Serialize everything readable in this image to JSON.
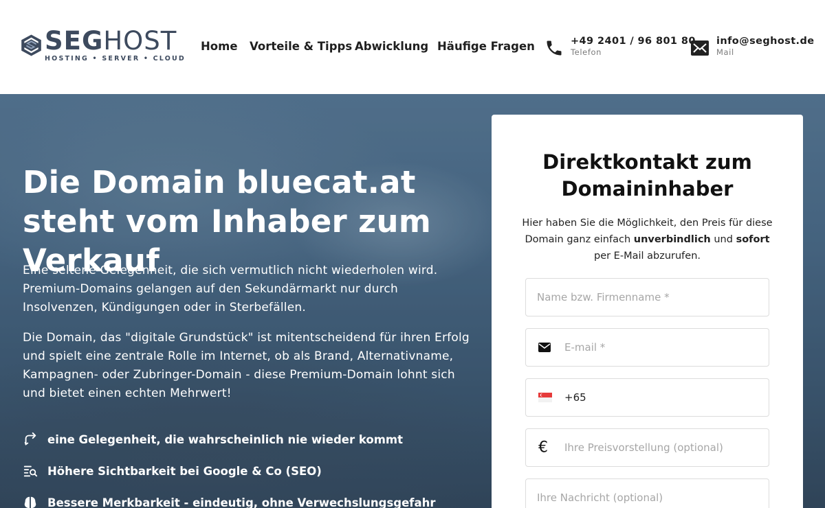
{
  "header": {
    "logo": {
      "name_bold": "SEG",
      "name_light": "HOST",
      "tagline": "HOSTING • SERVER • CLOUD"
    },
    "nav": [
      {
        "label": "Home"
      },
      {
        "label": "Vorteile & Tipps"
      },
      {
        "label": "Abwicklung"
      },
      {
        "label": "Häufige Fragen"
      }
    ],
    "phone": {
      "value": "+49 2401 / 96 801 80",
      "label": "Telefon",
      "icon": "phone-icon"
    },
    "mail": {
      "value": "info@seghost.de",
      "label": "Mail",
      "icon": "mail-icon"
    }
  },
  "hero": {
    "title": "Die Domain bluecat.at steht vom Inhaber zum Verkauf",
    "paragraph1": "Eine seltene Gelegenheit, die sich vermutlich nicht wiederholen wird. Premium-Domains gelangen auf den Sekundärmarkt nur durch Insolvenzen, Kündigungen oder in Sterbefällen.",
    "paragraph2": "Die Domain, das \"digitale Grundstück\" ist mitentscheidend für ihren Erfolg und spielt eine zentrale Rolle im Internet, ob als Brand, Alternativname, Kampagnen- oder Zubringer-Domain - diese Premium-Domain lohnt sich und bietet einen echten Mehrwert!",
    "features": [
      {
        "text": "eine Gelegenheit, die wahrscheinlich nie wieder kommt",
        "icon": "swap-arrows-icon"
      },
      {
        "text": "Höhere Sichtbarkeit bei Google & Co (SEO)",
        "icon": "list-search-icon"
      },
      {
        "text": "Bessere Merkbarkeit - eindeutig, ohne Verwechslungsgefahr",
        "icon": "brain-icon"
      }
    ]
  },
  "form": {
    "title": "Direktkontakt zum Domaininhaber",
    "intro_1": "Hier haben Sie die Möglichkeit, den Preis für diese Domain ganz einfach ",
    "intro_bold_1": "unverbindlich",
    "intro_2": " und ",
    "intro_bold_2": "sofort",
    "intro_3": " per E-Mail abzurufen.",
    "name_placeholder": "Name bzw. Firmenname *",
    "email_placeholder": "E-mail *",
    "phone_value": "+65",
    "phone_flag": "singapore-flag-icon",
    "price_symbol": "€",
    "price_placeholder": "Ihre Preisvorstellung (optional)",
    "message_placeholder": "Ihre Nachricht (optional)"
  }
}
